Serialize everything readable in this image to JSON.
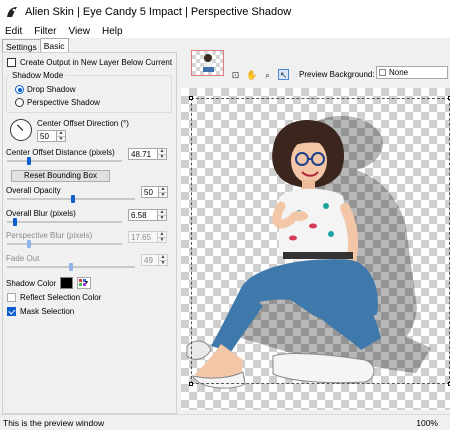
{
  "window": {
    "title": "Alien Skin | Eye Candy 5 Impact | Perspective Shadow"
  },
  "menu": [
    "Edit",
    "Filter",
    "View",
    "Help"
  ],
  "tabs": [
    {
      "label": "Settings"
    },
    {
      "label": "Basic"
    }
  ],
  "settings": {
    "create_output": {
      "label": "Create Output in New Layer Below Current",
      "checked": false
    },
    "shadow_mode": {
      "label": "Shadow Mode",
      "options": [
        {
          "label": "Drop Shadow",
          "selected": true
        },
        {
          "label": "Perspective Shadow",
          "selected": false
        }
      ]
    },
    "center_offset_direction": {
      "label": "Center Offset Direction (°)",
      "value": "50"
    },
    "center_offset_distance": {
      "label": "Center Offset Distance (pixels)",
      "value": "48.71"
    },
    "reset_button": {
      "label": "Reset Bounding Box"
    },
    "overall_opacity": {
      "label": "Overall Opacity",
      "value": "50"
    },
    "overall_blur": {
      "label": "Overall Blur (pixels)",
      "value": "6.58"
    },
    "perspective_blur": {
      "label": "Perspective Blur (pixels)",
      "value": "17.65",
      "disabled": true
    },
    "fade_out": {
      "label": "Fade Out",
      "value": "49",
      "disabled": true
    },
    "shadow_color": {
      "label": "Shadow Color",
      "color": "#000000"
    },
    "reflect_selection_color": {
      "label": "Reflect Selection Color",
      "checked": false
    },
    "mask_selection": {
      "label": "Mask Selection",
      "checked": true
    }
  },
  "preview": {
    "background_label": "Preview Background:",
    "background_value": "None"
  },
  "status": {
    "message": "This is the preview window",
    "zoom": "100%"
  }
}
